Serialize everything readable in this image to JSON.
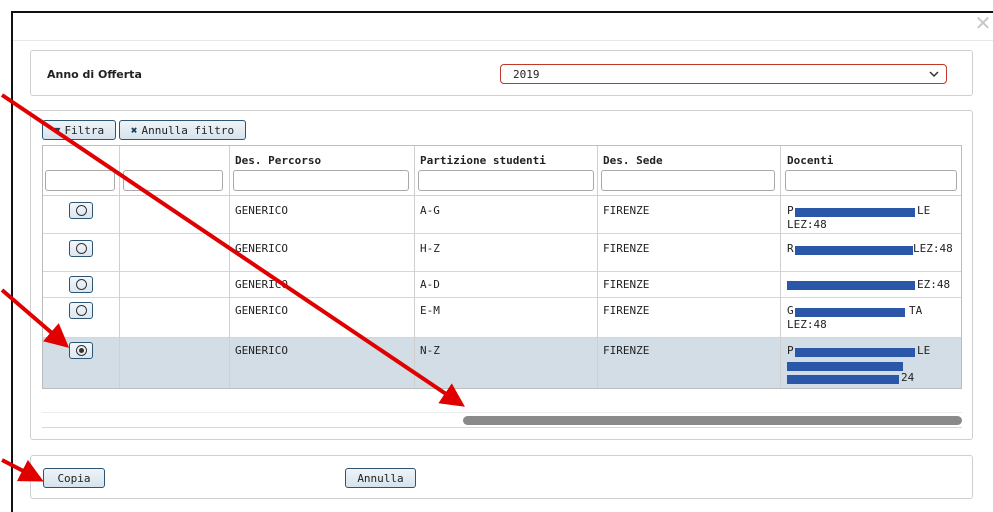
{
  "filter_panel": {
    "label": "Anno di Offerta",
    "selected_year": "2019"
  },
  "toolbar": {
    "filter_label": "Filtra",
    "clear_filter_label": "Annulla filtro"
  },
  "table": {
    "columns": [
      "",
      "",
      "Des. Percorso",
      "Partizione studenti",
      "Des. Sede",
      "Docenti"
    ],
    "rows": [
      {
        "percorso": "GENERICO",
        "partizione": "A-G",
        "sede": "FIRENZE",
        "docenti": [
          "P",
          "LE",
          "LEZ:48"
        ],
        "selected": false
      },
      {
        "percorso": "GENERICO",
        "partizione": "H-Z",
        "sede": "FIRENZE",
        "docenti": [
          "R",
          "LEZ:48"
        ],
        "selected": false
      },
      {
        "percorso": "GENERICO",
        "partizione": "A-D",
        "sede": "FIRENZE",
        "docenti": [
          "",
          "EZ:48"
        ],
        "selected": false
      },
      {
        "percorso": "GENERICO",
        "partizione": "E-M",
        "sede": "FIRENZE",
        "docenti": [
          "G",
          "TA",
          "LEZ:48"
        ],
        "selected": false
      },
      {
        "percorso": "GENERICO",
        "partizione": "N-Z",
        "sede": "FIRENZE",
        "docenti": [
          "P",
          "LE",
          "24"
        ],
        "selected": true
      }
    ]
  },
  "footer": {
    "copy_label": "Copia",
    "cancel_label": "Annulla"
  },
  "colors": {
    "accent_border": "#2c5573",
    "selected_row": "#d2dde6",
    "select_border": "#c0392b",
    "redaction": "#2a57a8",
    "annotation_arrow": "#e00000"
  },
  "icons": {
    "close": "close-icon",
    "filter": "funnel-icon",
    "clear_filter": "x-icon",
    "dropdown": "chevron-down-icon",
    "radio": "radio-icon"
  }
}
